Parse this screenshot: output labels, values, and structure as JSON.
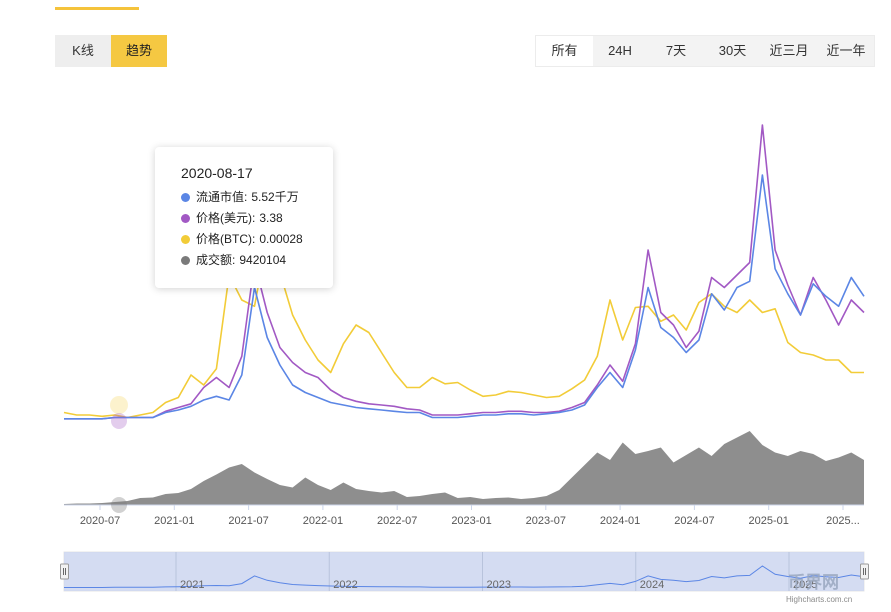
{
  "colors": {
    "market_cap": "#5b86e5",
    "price_usd": "#a259c4",
    "price_btc": "#f2cc38",
    "volume": "#7a7a7a",
    "accent": "#f5c842"
  },
  "view_toggle": [
    {
      "label": "K线",
      "active": false
    },
    {
      "label": "趋势",
      "active": true
    }
  ],
  "range_tabs": [
    {
      "label": "所有",
      "active": true
    },
    {
      "label": "24H",
      "active": false
    },
    {
      "label": "7天",
      "active": false
    },
    {
      "label": "30天",
      "active": false
    },
    {
      "label": "近三月",
      "active": false
    },
    {
      "label": "近一年",
      "active": false
    }
  ],
  "tooltip": {
    "date": "2020-08-17",
    "rows": [
      {
        "label": "流通市值",
        "value": "5.52千万",
        "color": "#5b86e5"
      },
      {
        "label": "价格(美元)",
        "value": "3.38",
        "color": "#a259c4"
      },
      {
        "label": "价格(BTC)",
        "value": "0.00028",
        "color": "#f2cc38"
      },
      {
        "label": "成交额",
        "value": "9420104",
        "color": "#7a7a7a"
      }
    ]
  },
  "chart_data": {
    "type": "line",
    "x_tick_labels": [
      "2020-07",
      "2021-01",
      "2021-07",
      "2022-01",
      "2022-07",
      "2023-01",
      "2023-07",
      "2024-01",
      "2024-07",
      "2025-01",
      "2025..."
    ],
    "navigator_labels": [
      "2021",
      "2022",
      "2023",
      "2024",
      "2025"
    ],
    "series": [
      {
        "key": "market_cap",
        "values": [
          5,
          5,
          5,
          5,
          6,
          6,
          6,
          6,
          10,
          12,
          15,
          20,
          23,
          20,
          40,
          110,
          70,
          48,
          32,
          26,
          22,
          18,
          16,
          14,
          13,
          12,
          11,
          10,
          10,
          6,
          6,
          6,
          7,
          8,
          8,
          9,
          9,
          8,
          9,
          10,
          12,
          16,
          30,
          42,
          30,
          60,
          110,
          78,
          70,
          58,
          68,
          105,
          92,
          110,
          115,
          200,
          125,
          105,
          88,
          113,
          103,
          95,
          118,
          103
        ]
      },
      {
        "key": "price_usd",
        "values": [
          5,
          5,
          5,
          5,
          6,
          6,
          6,
          6,
          11,
          14,
          17,
          30,
          38,
          30,
          55,
          130,
          90,
          62,
          50,
          42,
          38,
          28,
          22,
          19,
          17,
          16,
          15,
          13,
          12,
          8,
          8,
          8,
          9,
          10,
          10,
          11,
          11,
          10,
          10,
          11,
          14,
          18,
          32,
          48,
          35,
          65,
          140,
          90,
          80,
          62,
          75,
          118,
          110,
          120,
          130,
          240,
          140,
          112,
          88,
          118,
          100,
          80,
          100,
          90
        ]
      },
      {
        "key": "price_btc",
        "values": [
          10,
          8,
          8,
          7,
          8,
          6,
          8,
          10,
          18,
          22,
          40,
          32,
          45,
          120,
          100,
          95,
          150,
          122,
          88,
          68,
          52,
          42,
          65,
          80,
          74,
          58,
          42,
          30,
          30,
          38,
          33,
          34,
          28,
          23,
          24,
          27,
          26,
          24,
          22,
          23,
          29,
          36,
          55,
          100,
          68,
          94,
          95,
          83,
          88,
          76,
          98,
          105,
          95,
          90,
          100,
          90,
          93,
          66,
          58,
          56,
          52,
          52,
          42,
          42
        ]
      },
      {
        "key": "volume",
        "values": [
          0.2,
          0.3,
          0.3,
          0.4,
          0.6,
          0.8,
          1.4,
          1.5,
          2.2,
          2.4,
          3.2,
          4.8,
          6.1,
          7.5,
          8.2,
          6.5,
          5.2,
          4,
          3.5,
          5.5,
          4,
          3,
          4.5,
          3.2,
          2.8,
          2.5,
          2.8,
          1.6,
          1.8,
          2.2,
          2.5,
          1.4,
          1.6,
          1.2,
          1.4,
          1.5,
          1.2,
          1.4,
          1.8,
          3,
          5.5,
          8,
          10.5,
          9,
          12.5,
          10.2,
          10.8,
          11.5,
          8.5,
          10,
          11.5,
          9.8,
          12.2,
          13.5,
          14.8,
          12,
          10.5,
          9.8,
          10.8,
          10.2,
          8.8,
          9.5,
          10.5,
          9
        ]
      }
    ],
    "grid": false,
    "legend": "none"
  }
}
